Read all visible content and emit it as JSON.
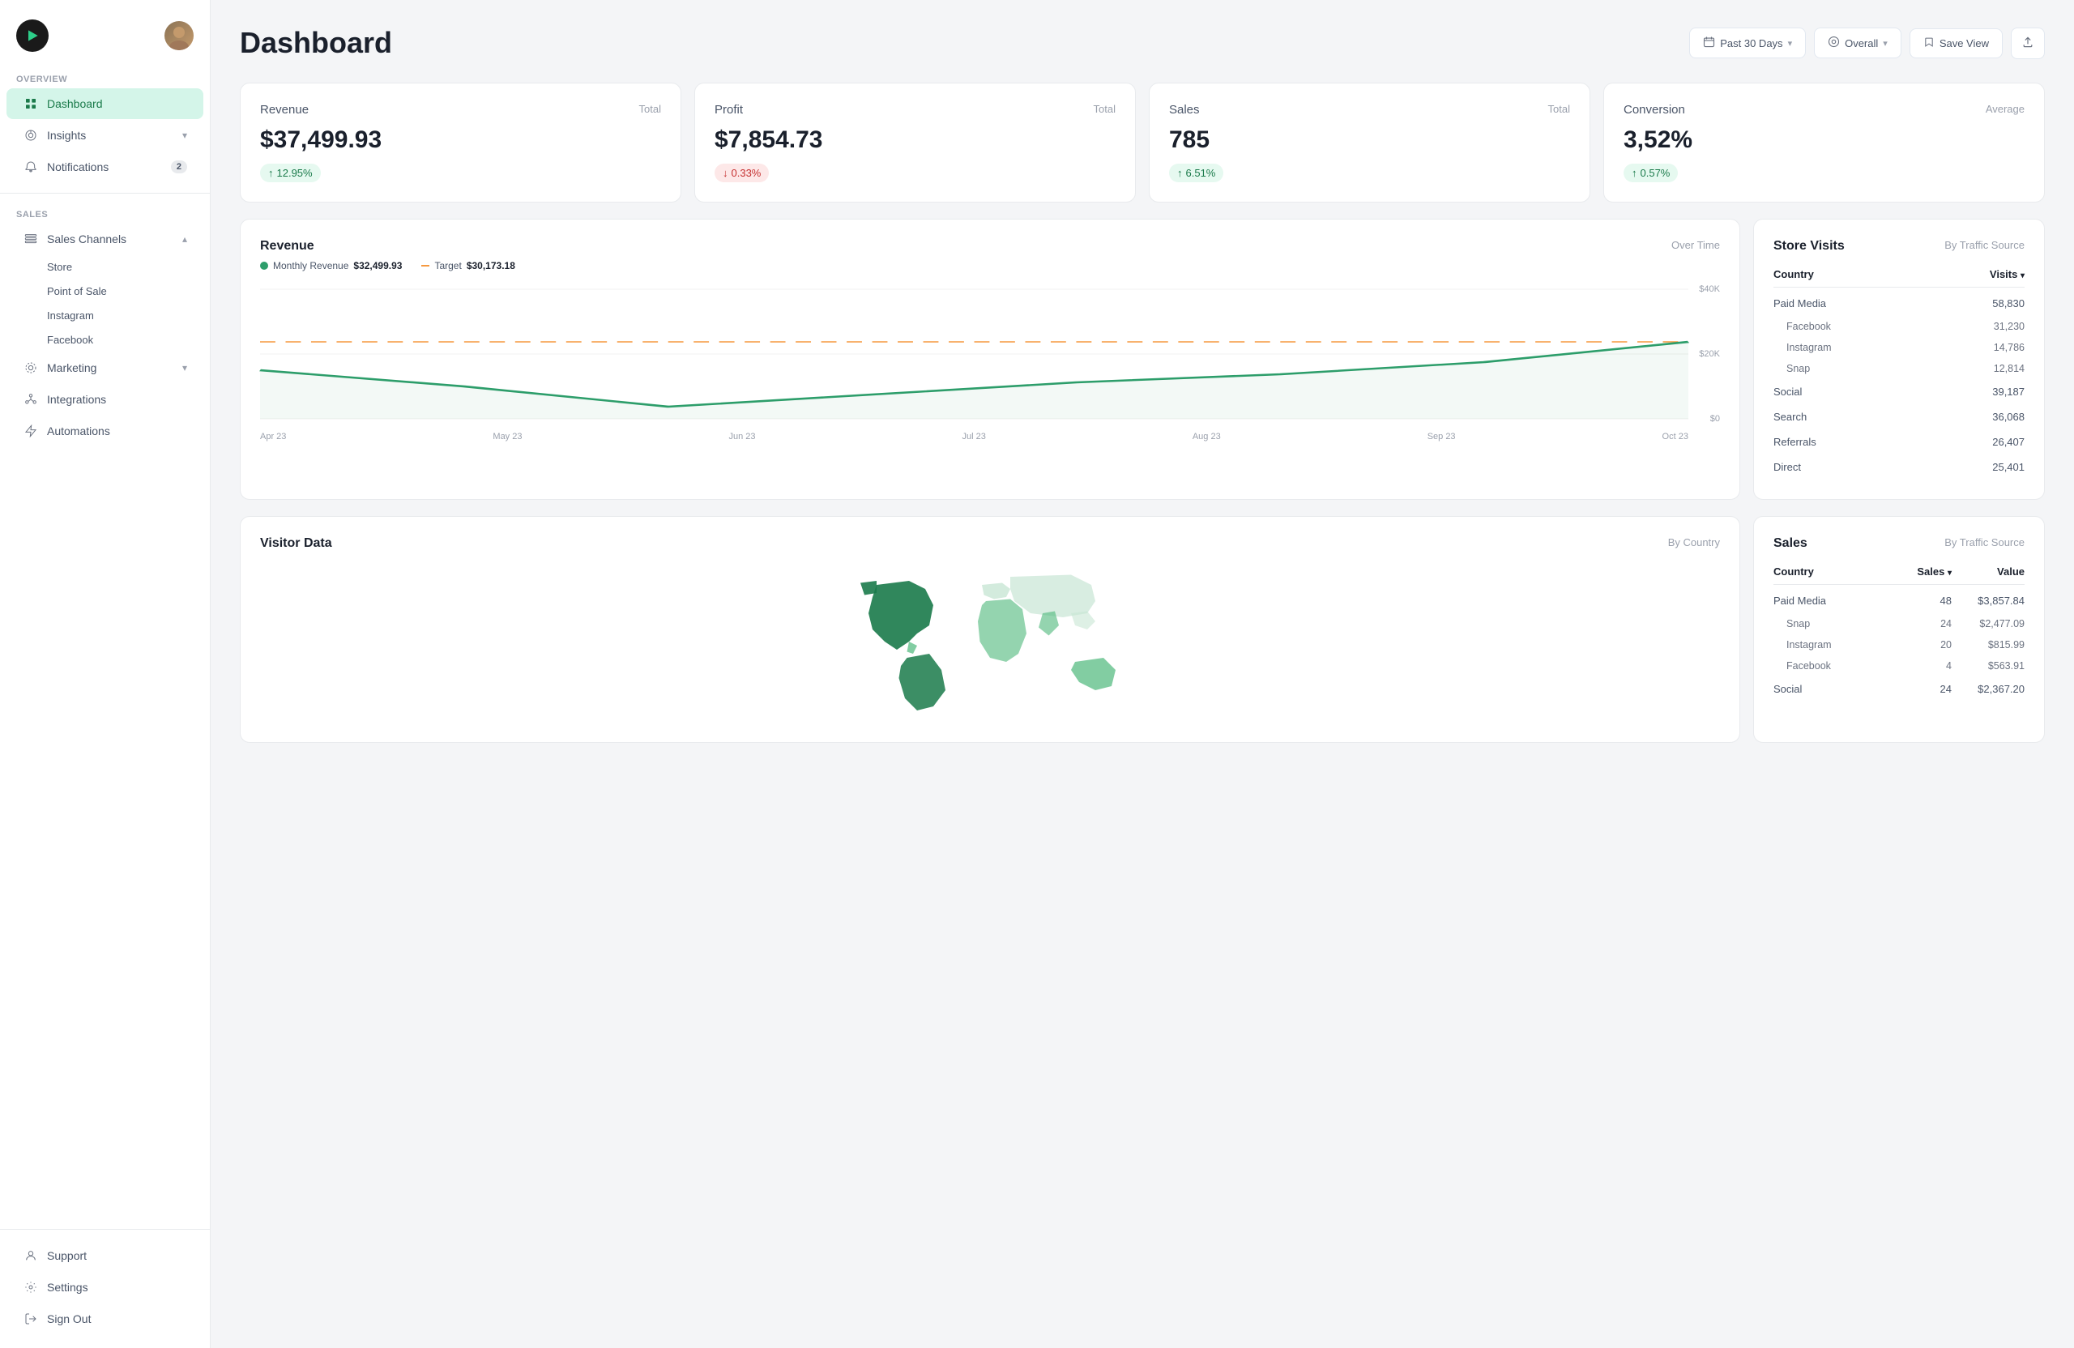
{
  "sidebar": {
    "overview_label": "Overview",
    "dashboard_label": "Dashboard",
    "insights_label": "Insights",
    "notifications_label": "Notifications",
    "notifications_badge": "2",
    "sales_label": "Sales",
    "sales_channels_label": "Sales Channels",
    "store_label": "Store",
    "point_of_sale_label": "Point of Sale",
    "instagram_label": "Instagram",
    "facebook_label": "Facebook",
    "marketing_label": "Marketing",
    "integrations_label": "Integrations",
    "automations_label": "Automations",
    "support_label": "Support",
    "settings_label": "Settings",
    "sign_out_label": "Sign Out"
  },
  "header": {
    "title": "Dashboard",
    "date_range": "Past 30 Days",
    "view_label": "Overall",
    "save_view_label": "Save View"
  },
  "stats": [
    {
      "label": "Revenue",
      "sublabel": "Total",
      "value": "$37,499.93",
      "change": "12.95%",
      "direction": "up"
    },
    {
      "label": "Profit",
      "sublabel": "Total",
      "value": "$7,854.73",
      "change": "0.33%",
      "direction": "down"
    },
    {
      "label": "Sales",
      "sublabel": "Total",
      "value": "785",
      "change": "6.51%",
      "direction": "up"
    },
    {
      "label": "Conversion",
      "sublabel": "Average",
      "value": "3,52%",
      "change": "0.57%",
      "direction": "up"
    }
  ],
  "revenue_chart": {
    "title": "Revenue",
    "subtitle": "Over Time",
    "legend_monthly": "Monthly Revenue",
    "legend_monthly_value": "$32,499.93",
    "legend_target": "Target",
    "legend_target_value": "$30,173.18",
    "y_labels": [
      "$40K",
      "$20K",
      "$0"
    ],
    "x_labels": [
      "Apr 23",
      "May 23",
      "Jun 23",
      "Jul 23",
      "Aug 23",
      "Sep 23",
      "Oct 23"
    ]
  },
  "store_visits": {
    "title": "Store Visits",
    "subtitle": "By Traffic Source",
    "col_country": "Country",
    "col_visits": "Visits",
    "rows": [
      {
        "label": "Paid Media",
        "value": "58,830",
        "sub": false
      },
      {
        "label": "Facebook",
        "value": "31,230",
        "sub": true
      },
      {
        "label": "Instagram",
        "value": "14,786",
        "sub": true
      },
      {
        "label": "Snap",
        "value": "12,814",
        "sub": true
      },
      {
        "label": "Social",
        "value": "39,187",
        "sub": false
      },
      {
        "label": "Search",
        "value": "36,068",
        "sub": false
      },
      {
        "label": "Referrals",
        "value": "26,407",
        "sub": false
      },
      {
        "label": "Direct",
        "value": "25,401",
        "sub": false
      }
    ]
  },
  "visitor_data": {
    "title": "Visitor Data",
    "subtitle": "By Country"
  },
  "sales_table": {
    "title": "Sales",
    "subtitle": "By Traffic Source",
    "col_country": "Country",
    "col_sales": "Sales",
    "col_value": "Value",
    "rows": [
      {
        "label": "Paid Media",
        "sales": "48",
        "value": "$3,857.84",
        "sub": false
      },
      {
        "label": "Snap",
        "sales": "24",
        "value": "$2,477.09",
        "sub": true
      },
      {
        "label": "Instagram",
        "sales": "20",
        "value": "$815.99",
        "sub": true
      },
      {
        "label": "Facebook",
        "sales": "4",
        "value": "$563.91",
        "sub": true
      },
      {
        "label": "Social",
        "sales": "24",
        "value": "$2,367.20",
        "sub": false
      }
    ]
  }
}
